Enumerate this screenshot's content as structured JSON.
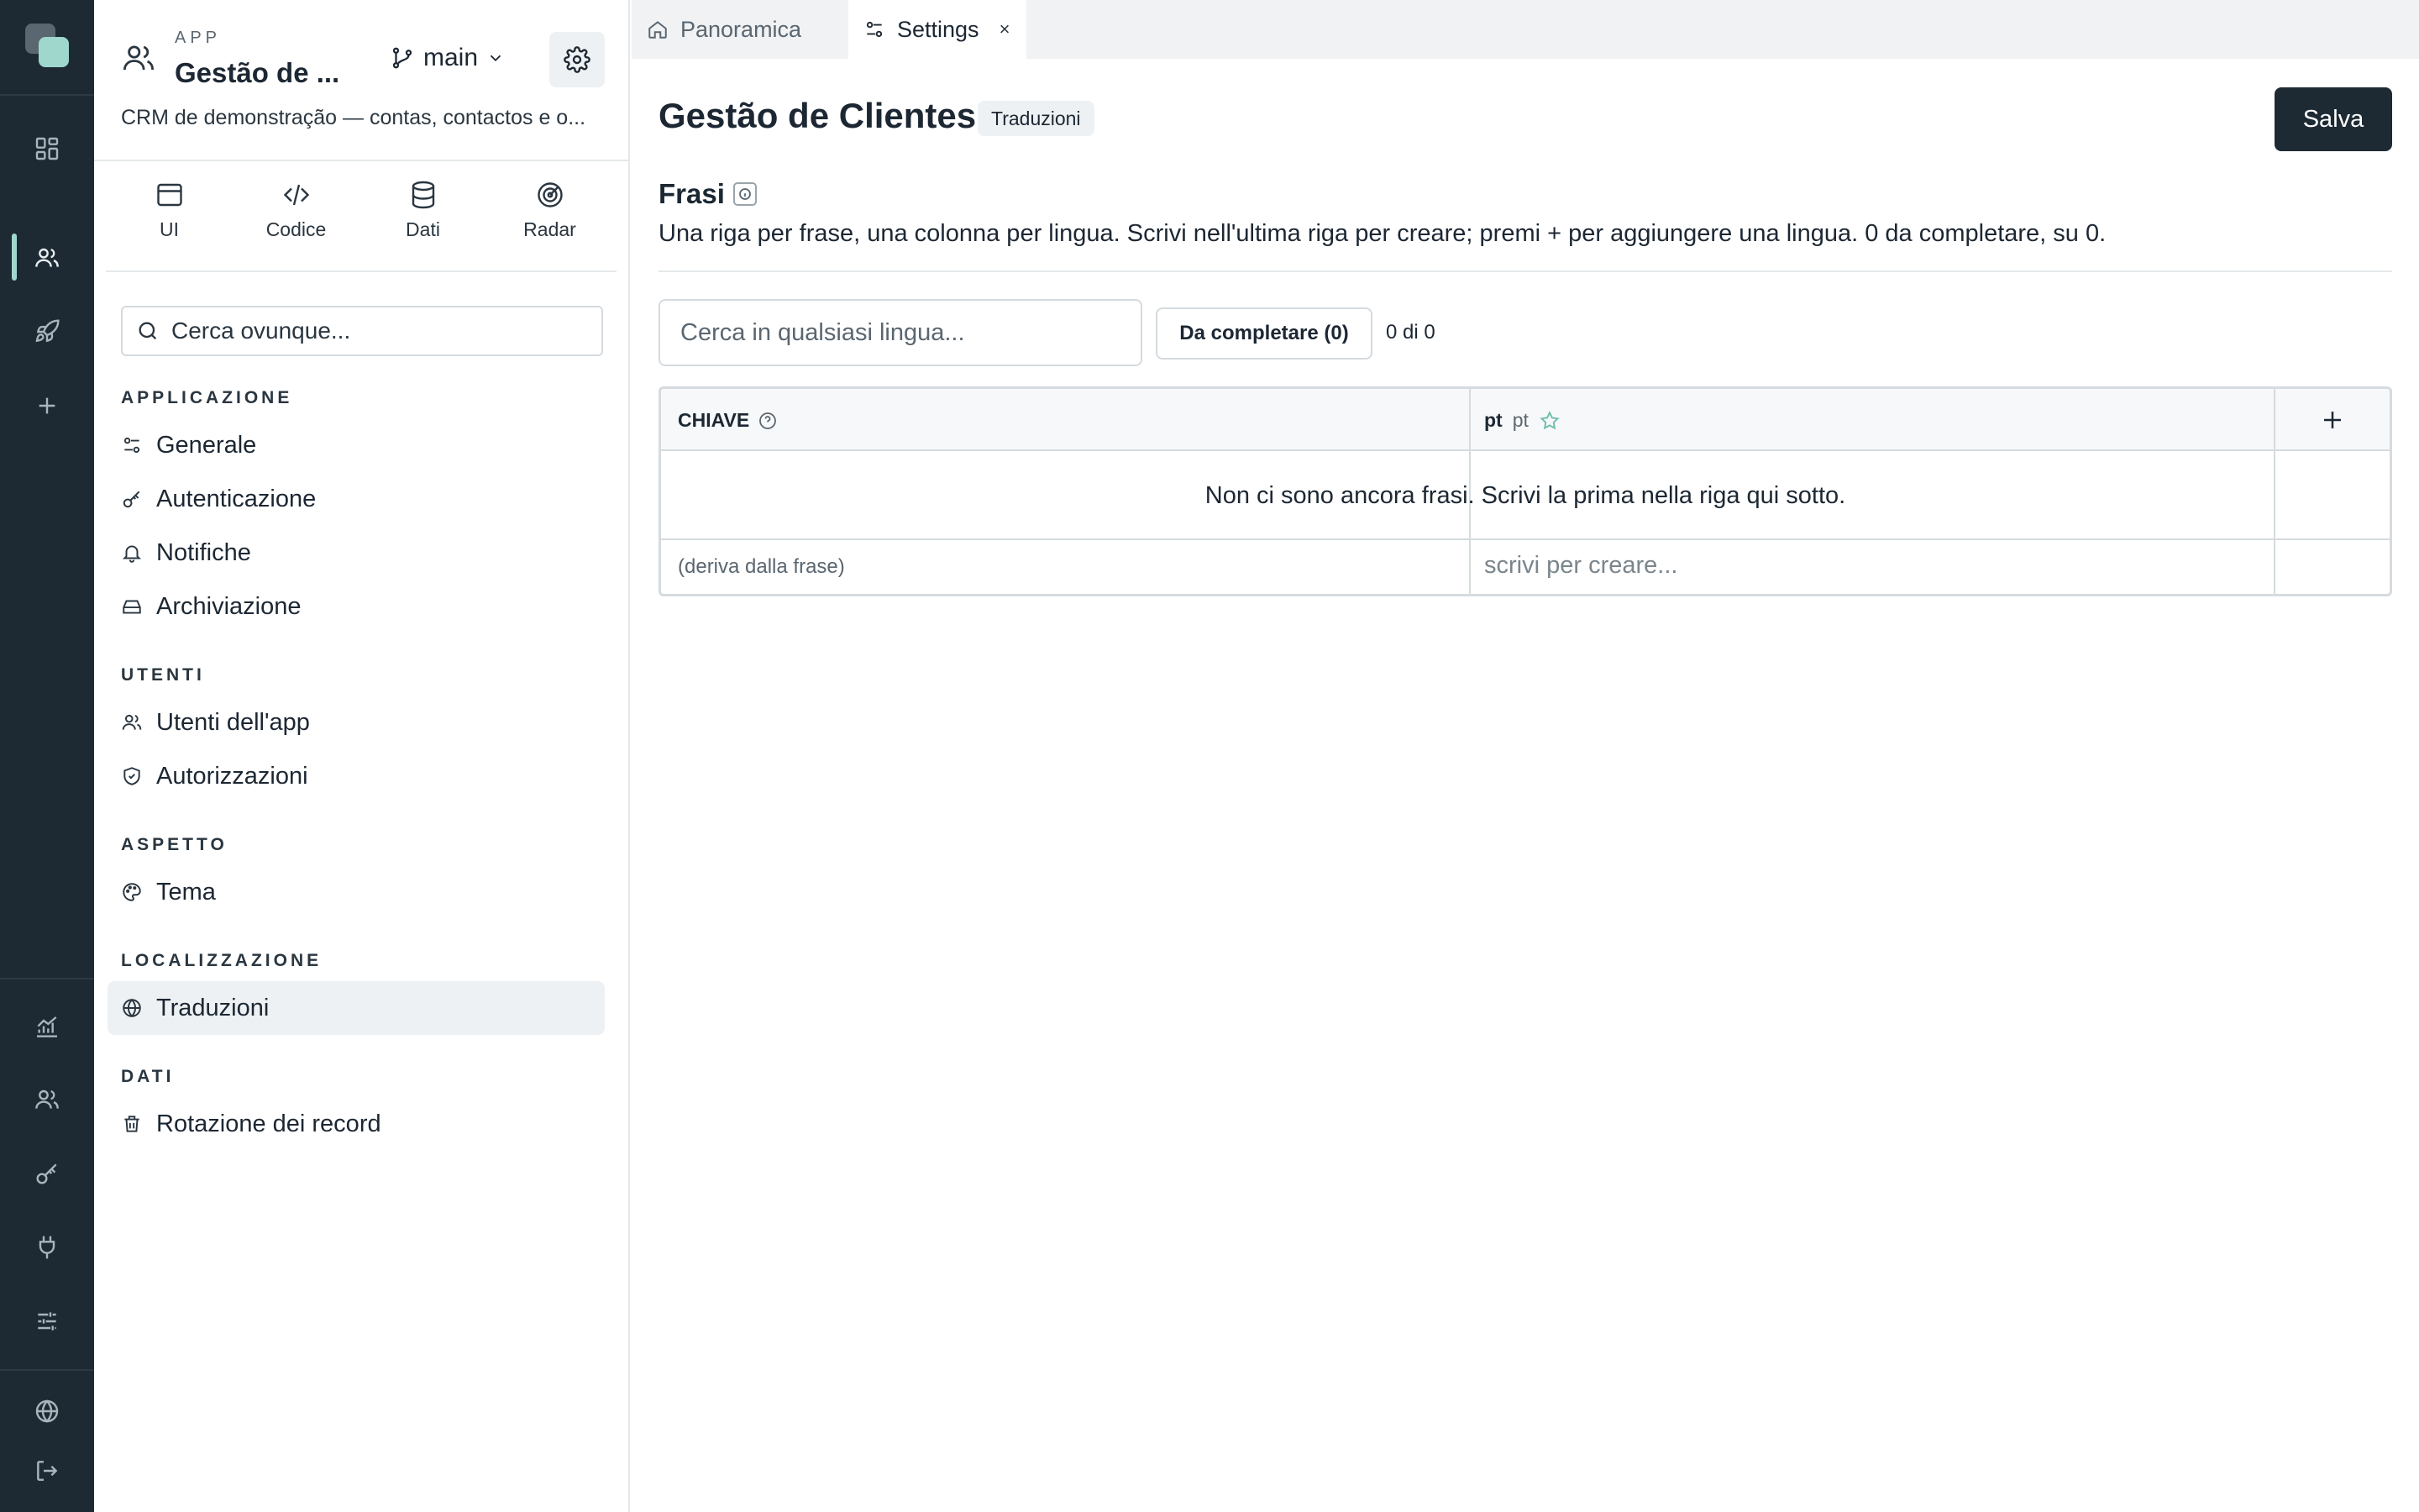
{
  "rail": {
    "top_icons": [
      "dashboard-icon",
      "users-icon",
      "rocket-icon",
      "plus-icon"
    ],
    "bottom_icons": [
      "analytics-icon",
      "team-icon",
      "key-icon",
      "plug-icon",
      "sliders-icon",
      "globe-icon",
      "logout-icon"
    ],
    "active": "users-icon"
  },
  "app": {
    "kicker": "APP",
    "title": "Gestão de ...",
    "branch": "main",
    "description": "CRM de demonstração — contas, contactos e o..."
  },
  "modes": [
    {
      "label": "UI",
      "icon": "window-icon"
    },
    {
      "label": "Codice",
      "icon": "code-icon"
    },
    {
      "label": "Dati",
      "icon": "database-icon"
    },
    {
      "label": "Radar",
      "icon": "radar-icon"
    }
  ],
  "sidebar_search": {
    "placeholder": "Cerca ovunque..."
  },
  "nav": {
    "sections": [
      {
        "title": "APPLICAZIONE",
        "items": [
          {
            "label": "Generale",
            "icon": "settings-sliders-icon"
          },
          {
            "label": "Autenticazione",
            "icon": "key-icon"
          },
          {
            "label": "Notifiche",
            "icon": "bell-icon"
          },
          {
            "label": "Archiviazione",
            "icon": "storage-icon"
          }
        ]
      },
      {
        "title": "UTENTI",
        "items": [
          {
            "label": "Utenti dell'app",
            "icon": "users-icon"
          },
          {
            "label": "Autorizzazioni",
            "icon": "shield-icon"
          }
        ]
      },
      {
        "title": "ASPETTO",
        "items": [
          {
            "label": "Tema",
            "icon": "palette-icon"
          }
        ]
      },
      {
        "title": "LOCALIZZAZIONE",
        "items": [
          {
            "label": "Traduzioni",
            "icon": "globe-icon",
            "active": true
          }
        ]
      },
      {
        "title": "DATI",
        "items": [
          {
            "label": "Rotazione dei record",
            "icon": "trash-icon"
          }
        ]
      }
    ]
  },
  "tabs": [
    {
      "label": "Panoramica",
      "icon": "home-icon",
      "active": false
    },
    {
      "label": "Settings",
      "icon": "settings-sliders-icon",
      "active": true,
      "close": "×"
    }
  ],
  "main": {
    "title": "Gestão de Clientes",
    "badge": "Traduzioni",
    "save_label": "Salva",
    "section_title": "Frasi",
    "section_desc": "Una riga per frase, una colonna per lingua. Scrivi nell'ultima riga per creare; premi + per aggiungere una lingua. 0 da completare, su 0.",
    "search_placeholder": "Cerca in qualsiasi lingua...",
    "filter_label": "Da completare (0)",
    "count": "0 di 0"
  },
  "grid": {
    "key_header": "CHIAVE",
    "lang_code": "pt",
    "lang_name": "pt",
    "empty_message": "Non ci sono ancora frasi. Scrivi la prima nella riga qui sotto.",
    "new_key_hint": "(deriva dalla frase)",
    "new_value_placeholder": "scrivi per creare..."
  },
  "colors": {
    "rail_bg": "#1d2a34",
    "accent": "#9fd7cd",
    "primary_button": "#1d2a34"
  }
}
